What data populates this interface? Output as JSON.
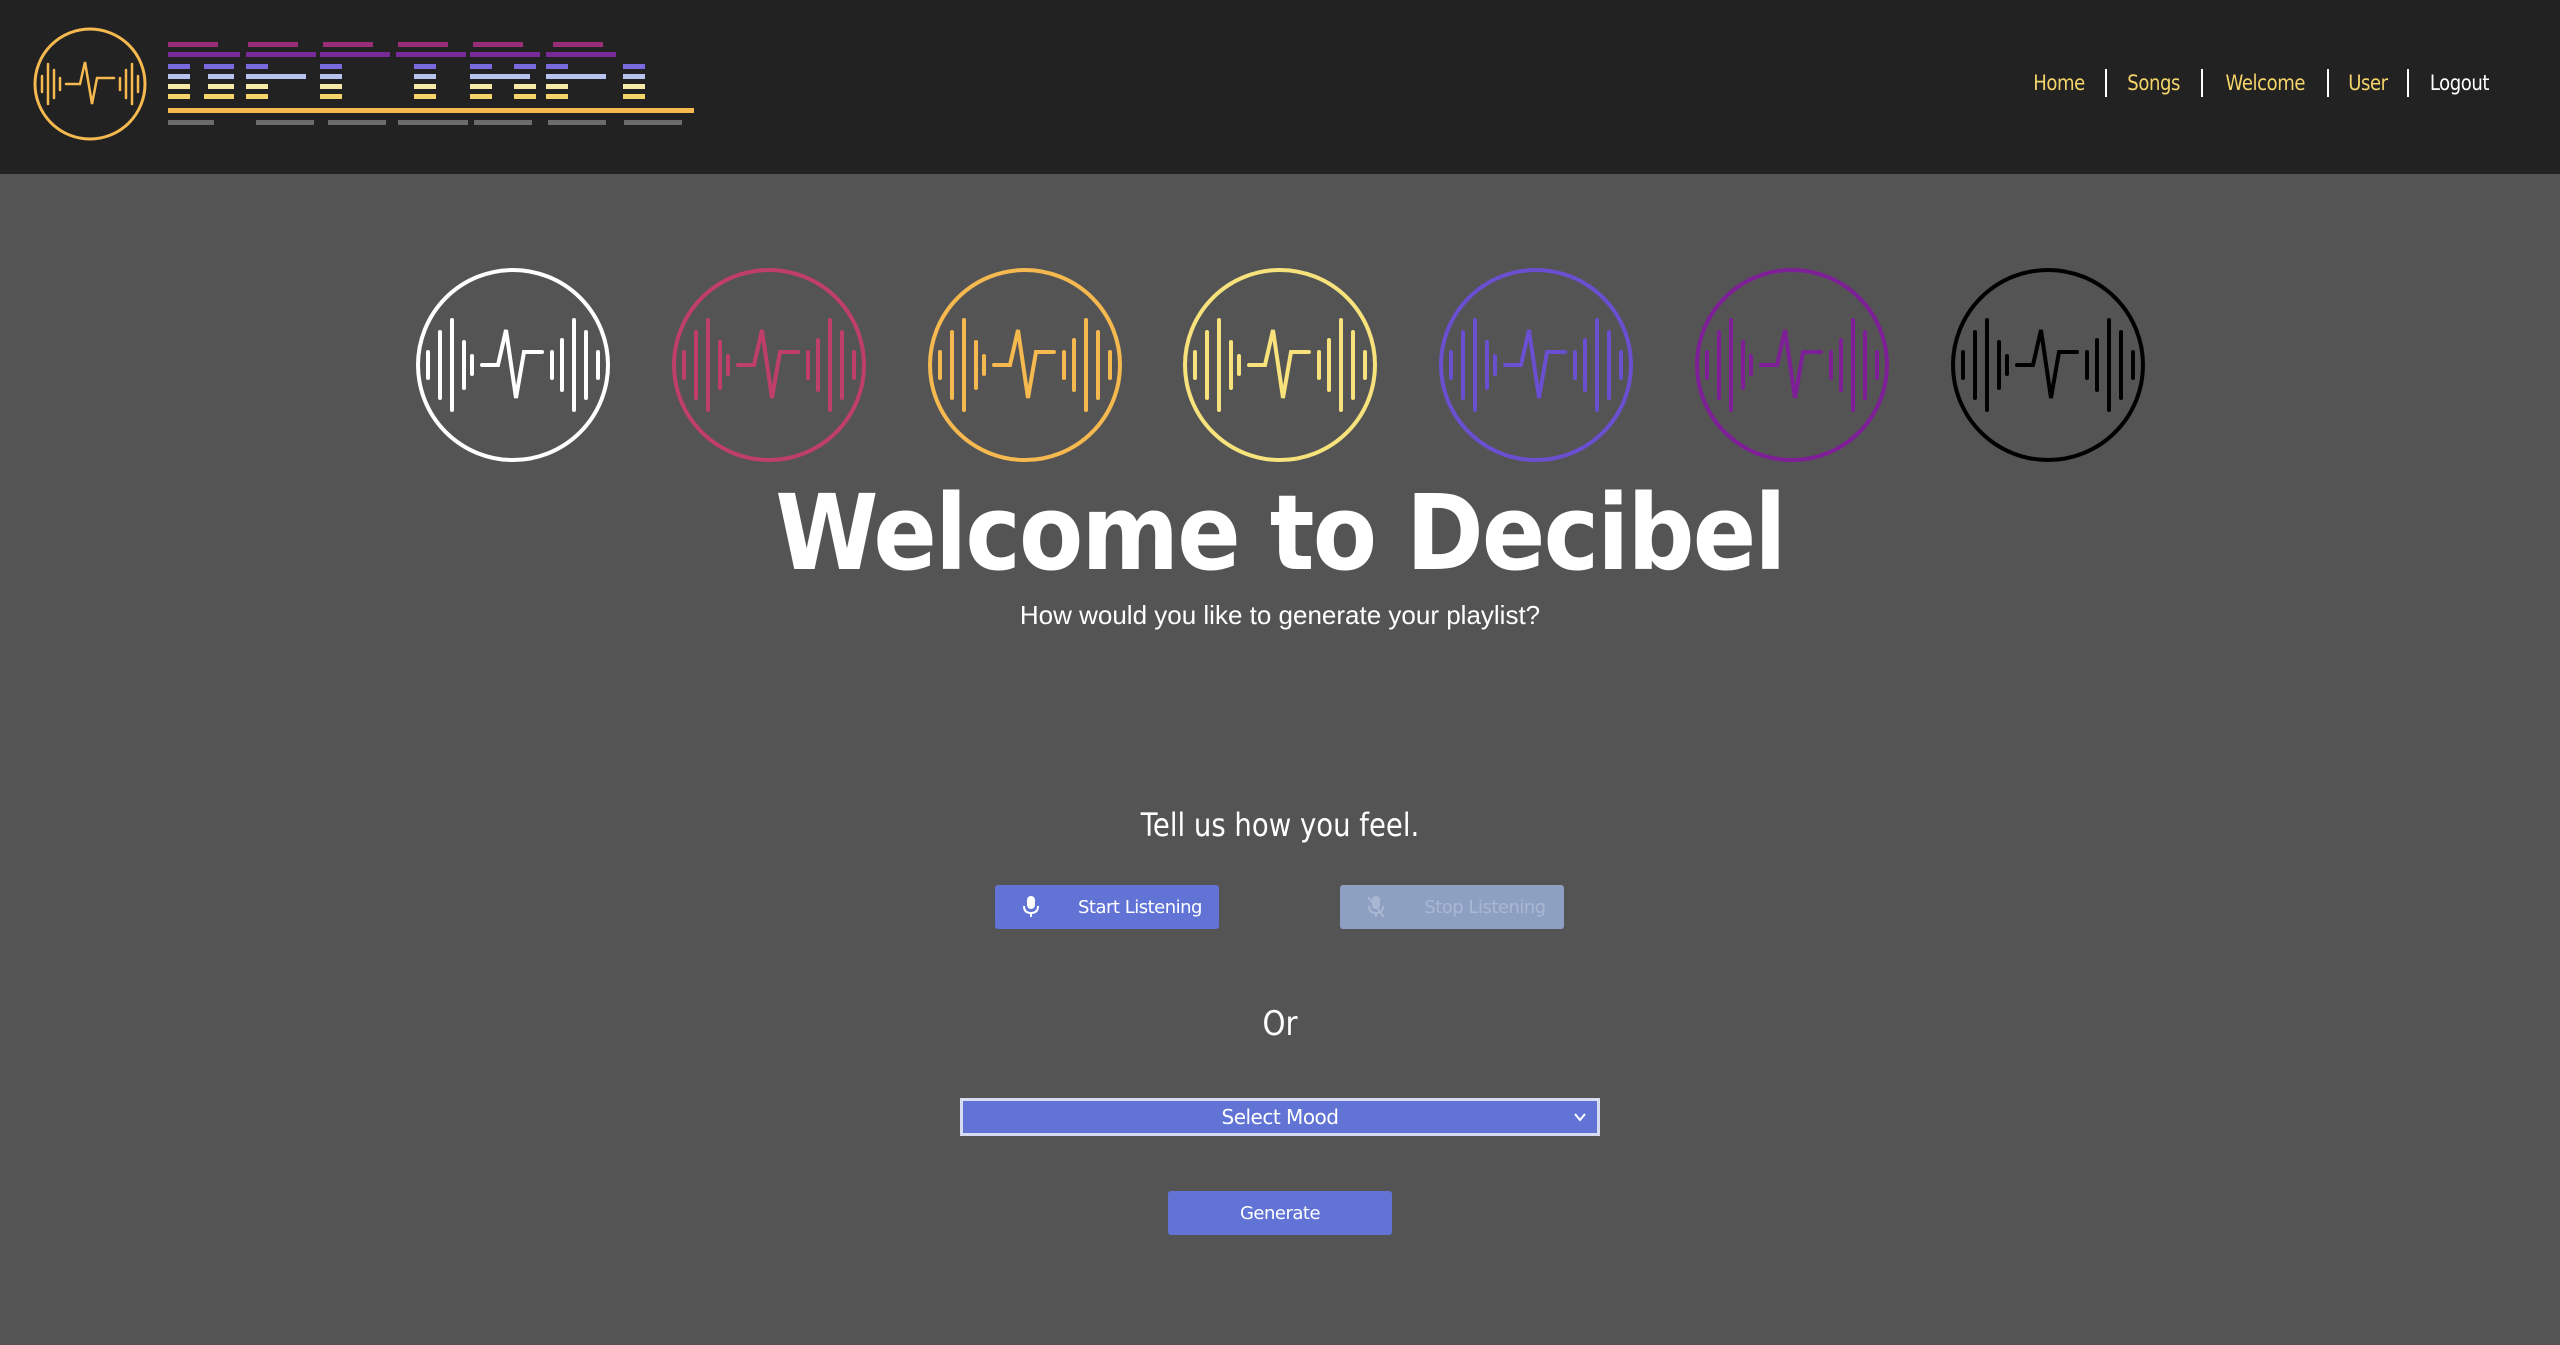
{
  "nav": {
    "items": [
      {
        "label": "Home"
      },
      {
        "label": "Songs"
      },
      {
        "label": "Welcome"
      },
      {
        "label": "User"
      },
      {
        "label": "Logout"
      }
    ]
  },
  "logo": {
    "emblem_icon": "sound-wave-emblem-icon",
    "wordmark": "DECIBEL",
    "accent_color": "#f5b94f"
  },
  "emblems": [
    {
      "icon": "sound-wave-emblem-icon",
      "color": "#ffffff"
    },
    {
      "icon": "sound-wave-emblem-icon",
      "color": "#c03f6a"
    },
    {
      "icon": "sound-wave-emblem-icon",
      "color": "#f5b94f"
    },
    {
      "icon": "sound-wave-emblem-icon",
      "color": "#f7e27c"
    },
    {
      "icon": "sound-wave-emblem-icon",
      "color": "#6a4fd0"
    },
    {
      "icon": "sound-wave-emblem-icon",
      "color": "#7e1f98"
    },
    {
      "icon": "sound-wave-emblem-icon",
      "color": "#000000"
    }
  ],
  "main": {
    "title": "Welcome to Decibel",
    "subtitle": "How would you like to generate your playlist?",
    "feel_heading": "Tell us how you feel.",
    "start_listening": "Start Listening",
    "stop_listening": "Stop Listening",
    "or": "Or",
    "mood_select": "Select Mood",
    "generate": "Generate"
  },
  "colors": {
    "background": "#545454",
    "header": "#222222",
    "button": "#6174d6",
    "button_disabled": "#8ea0c2",
    "nav_link": "#f5d46a"
  }
}
